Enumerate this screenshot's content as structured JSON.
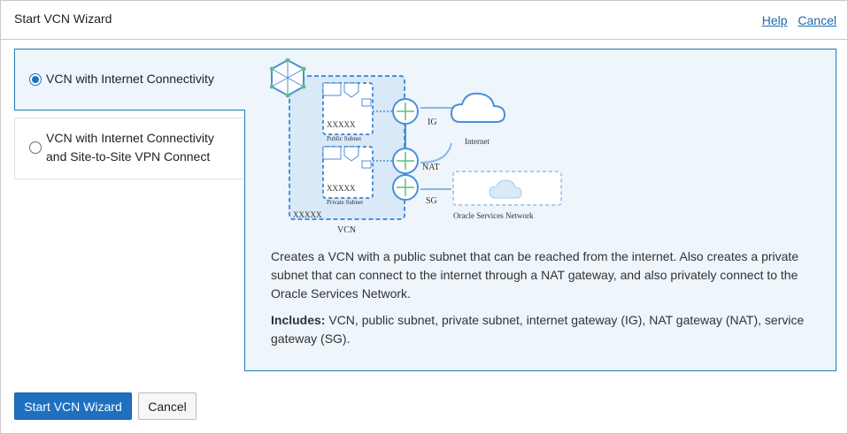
{
  "header": {
    "title": "Start VCN Wizard",
    "help": "Help",
    "cancel": "Cancel"
  },
  "options": [
    {
      "label": "VCN with Internet Connectivity",
      "selected": true
    },
    {
      "label": "VCN with Internet Connectivity and Site-to-Site VPN Connect",
      "selected": false
    }
  ],
  "diagram": {
    "public_subnet_label": "Public Subnet",
    "private_subnet_label": "Private Subnet",
    "cidr_public": "XXXXX",
    "cidr_private": "XXXXX",
    "cidr_vcn": "XXXXX",
    "vcn_label": "VCN",
    "ig_label": "IG",
    "nat_label": "NAT",
    "sg_label": "SG",
    "internet_label": "Internet",
    "osn_label": "Oracle Services Network"
  },
  "description": "Creates a VCN with a public subnet that can be reached from the internet. Also creates a private subnet that can connect to the internet through a NAT gateway, and also privately connect to the Oracle Services Network.",
  "includes": {
    "heading": "Includes:",
    "text": " VCN, public subnet, private subnet, internet gateway (IG), NAT gateway (NAT), service gateway (SG)."
  },
  "footer": {
    "primary": "Start VCN Wizard",
    "secondary": "Cancel"
  },
  "colors": {
    "accent": "#1f70c1",
    "panel_bg": "#eef5fb",
    "diagram_blue": "#4a90d9"
  }
}
